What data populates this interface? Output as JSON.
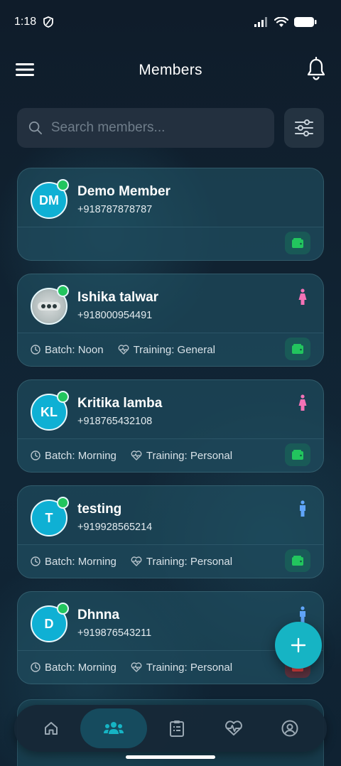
{
  "status_bar": {
    "time": "1:18"
  },
  "header": {
    "title": "Members"
  },
  "search": {
    "placeholder": "Search members..."
  },
  "members": [
    {
      "initials": "DM",
      "name": "Demo Member",
      "phone": "+918787878787",
      "batch": "",
      "training": "",
      "gender": "",
      "wallet_color": "green",
      "online": true
    },
    {
      "initials": "",
      "name": "Ishika talwar",
      "phone": "+918000954491",
      "batch": "Batch: Noon",
      "training": "Training: General",
      "gender": "female",
      "wallet_color": "green",
      "online": true
    },
    {
      "initials": "KL",
      "name": "Kritika lamba",
      "phone": "+918765432108",
      "batch": "Batch: Morning",
      "training": "Training: Personal",
      "gender": "female",
      "wallet_color": "green",
      "online": true
    },
    {
      "initials": "T",
      "name": "testing",
      "phone": "+919928565214",
      "batch": "Batch: Morning",
      "training": "Training: Personal",
      "gender": "male",
      "wallet_color": "green",
      "online": true
    },
    {
      "initials": "D",
      "name": "Dhnna",
      "phone": "+919876543211",
      "batch": "Batch: Morning",
      "training": "Training: Personal",
      "gender": "male",
      "wallet_color": "red",
      "online": true
    }
  ],
  "colors": {
    "accent": "#16b4c4",
    "online": "#22c55e",
    "female": "#f472b6",
    "male": "#60a5fa"
  },
  "nav": [
    {
      "icon": "home-icon",
      "active": false
    },
    {
      "icon": "members-icon",
      "active": true
    },
    {
      "icon": "clipboard-icon",
      "active": false
    },
    {
      "icon": "heart-pulse-icon",
      "active": false
    },
    {
      "icon": "profile-icon",
      "active": false
    }
  ]
}
